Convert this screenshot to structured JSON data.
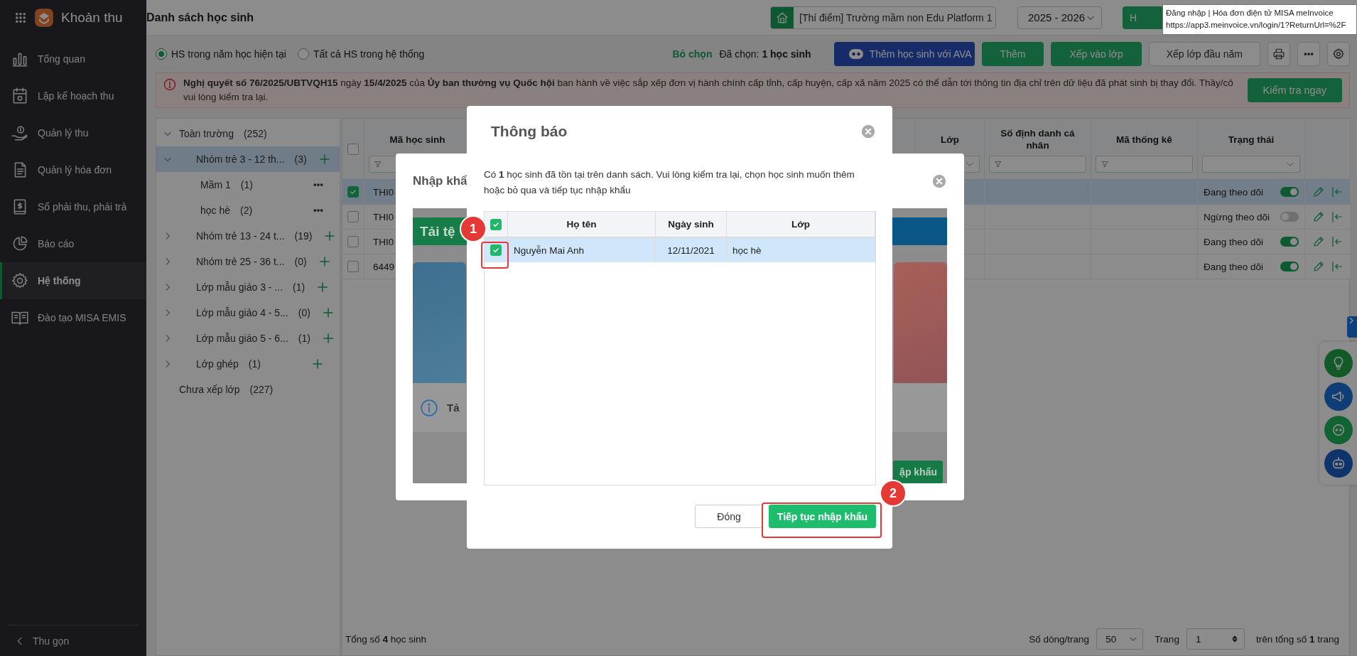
{
  "topbar": {
    "app_title": "Khoản thu",
    "page_title": "Danh sách học sinh",
    "school": "[Thí điểm] Trường mầm non Edu Platform 1",
    "year": "2025 - 2026",
    "partial_button": "H"
  },
  "tooltip": {
    "title": "Đăng nhập | Hóa đơn điện tử MISA meInvoice",
    "url": "https://app3.meinvoice.vn/login/1?ReturnUrl=%2F"
  },
  "sidebar": {
    "items": [
      {
        "label": "Tổng quan",
        "selected": false
      },
      {
        "label": "Lập kế hoạch thu",
        "selected": false
      },
      {
        "label": "Quản lý thu",
        "selected": false
      },
      {
        "label": "Quản lý hóa đơn",
        "selected": false
      },
      {
        "label": "Sổ phải thu, phải trả",
        "selected": false
      },
      {
        "label": "Báo cáo",
        "selected": false
      },
      {
        "label": "Hệ thống",
        "selected": true
      },
      {
        "label": "Đào tạo MISA EMIS",
        "selected": false
      }
    ],
    "collapse": "Thu gọn"
  },
  "toolbar": {
    "scope_options": [
      {
        "label": "HS trong năm học hiện tại",
        "selected": true
      },
      {
        "label": "Tất cả HS trong hệ thống",
        "selected": false
      }
    ],
    "deselect": "Bỏ chọn",
    "selected_count": "Đã chọn: **1 học sinh**",
    "buttons": [
      {
        "label": "Thêm học sinh với AVA",
        "kind": "ava"
      },
      {
        "label": "Thêm",
        "kind": "primary"
      },
      {
        "label": "Xếp vào lớp",
        "kind": "primary"
      },
      {
        "label": "Xếp lớp đầu năm",
        "kind": "secondary"
      }
    ]
  },
  "notice": {
    "text": "**Nghị quyết số 76/2025/UBTVQH15** ngày **15/4/2025** của **Ủy ban thường vụ Quốc hội** ban hành về việc sắp xếp đơn vị hành chính cấp tỉnh, cấp huyện, cấp xã năm 2025 có thể dẫn tới thông tin địa chỉ trên dữ liệu đã phát sinh bị thay đổi. Thầy/cô vui lòng kiểm tra lại.",
    "button": "Kiểm tra ngay"
  },
  "tree": {
    "items": [
      {
        "label": "Toàn trường",
        "count": "(252)",
        "kind": "root",
        "expanded": true,
        "selected": false,
        "children": [
          {
            "label": "Nhóm trẻ 3 - 12 th...",
            "count": "(3)",
            "kind": "group",
            "expanded": true,
            "selected": true,
            "children": [
              {
                "label": "Mầm 1",
                "count": "(1)",
                "kind": "class",
                "selected": false
              },
              {
                "label": "học hè",
                "count": "(2)",
                "kind": "class",
                "selected": false
              }
            ]
          },
          {
            "label": "Nhóm trẻ 13 - 24 t...",
            "count": "(19)",
            "kind": "group",
            "expanded": false,
            "selected": false
          },
          {
            "label": "Nhóm trẻ 25 - 36 t...",
            "count": "(0)",
            "kind": "group",
            "expanded": false,
            "selected": false
          },
          {
            "label": "Lớp mẫu giáo 3 - ...",
            "count": "(1)",
            "kind": "group",
            "expanded": false,
            "selected": false
          },
          {
            "label": "Lớp mẫu giáo 4 - 5...",
            "count": "(0)",
            "kind": "group",
            "expanded": false,
            "selected": false
          },
          {
            "label": "Lớp mẫu giáo 5 - 6...",
            "count": "(1)",
            "kind": "group",
            "expanded": false,
            "selected": false
          },
          {
            "label": "Lớp ghép",
            "count": "(1)",
            "kind": "group",
            "expanded": false,
            "selected": false
          },
          {
            "label": "Chưa xếp lớp",
            "count": "(227)",
            "kind": "unassigned",
            "selected": false
          }
        ]
      }
    ]
  },
  "table": {
    "all_checked": false,
    "columns": [
      {
        "label": "Mã học sinh",
        "kind": "text"
      },
      {
        "label": "Lớp",
        "kind": "select"
      },
      {
        "label": "Số định danh cá nhân",
        "kind": "text"
      },
      {
        "label": "Mã thống kê",
        "kind": "text"
      },
      {
        "label": "Trạng thái",
        "kind": "select"
      }
    ],
    "rows": [
      {
        "code": "THI0",
        "status": "Đang theo dõi",
        "tracking": true,
        "selected": true
      },
      {
        "code": "THI0",
        "status": "Ngừng theo dõi",
        "tracking": false,
        "selected": false
      },
      {
        "code": "THI0",
        "status": "Đang theo dõi",
        "tracking": true,
        "selected": false
      },
      {
        "code": "6449",
        "status": "Đang theo dõi",
        "tracking": true,
        "selected": false
      }
    ]
  },
  "footer": {
    "total": "Tổng số **4** học sinh",
    "rows_label": "Số dòng/trang",
    "rows_value": "50",
    "page_label": "Trang",
    "page_value": "1",
    "page_total": "trên tổng số **1** trang"
  },
  "import_dialog": {
    "title": "Nhập khẩ",
    "banner": "Tải tệ",
    "info": "Tả",
    "button": "ập khẩu"
  },
  "notice_dialog": {
    "title": "Thông báo",
    "message": "Có **1** học sinh đã tồn tại trên danh sách. Vui lòng kiểm tra lại, chọn học sinh muốn thêm hoặc bỏ qua và tiếp tục nhập khẩu",
    "all_checked": true,
    "columns": [
      "Họ tên",
      "Ngày sinh",
      "Lớp"
    ],
    "rows": [
      {
        "name": "Nguyễn Mai Anh",
        "dob": "12/11/2021",
        "class": "học hè",
        "checked": true,
        "selected": true
      }
    ],
    "buttons": [
      {
        "label": "Đóng",
        "kind": "secondary"
      },
      {
        "label": "Tiếp tục nhập khẩu",
        "kind": "primary"
      }
    ]
  },
  "annotations": [
    {
      "label": "1"
    },
    {
      "label": "2"
    }
  ]
}
